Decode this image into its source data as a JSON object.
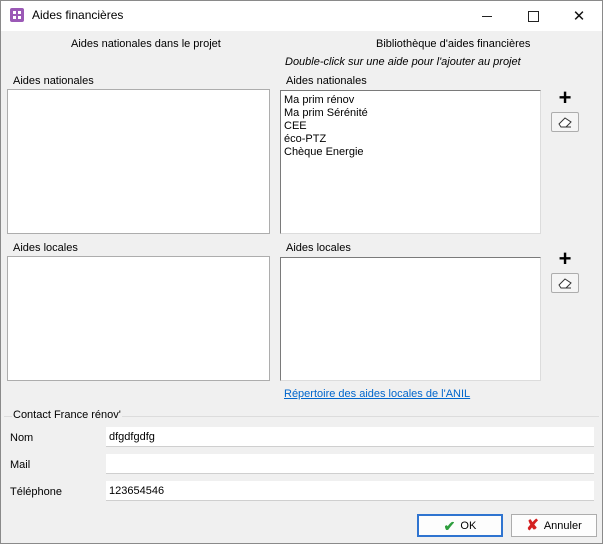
{
  "window": {
    "title": "Aides financières",
    "icon": "app-icon",
    "controls": {
      "minimize": "minimize-icon",
      "maximize": "maximize-icon",
      "close": "close-icon"
    }
  },
  "left": {
    "heading": "Aides nationales dans le projet",
    "national_label": "Aides nationales",
    "local_label": "Aides locales"
  },
  "right": {
    "heading": "Bibliothèque d'aides financières",
    "hint": "Double-click sur une aide pour l'ajouter au projet",
    "national_label": "Aides nationales",
    "national_items": [
      "Ma prim rénov",
      "Ma prim Sérénité",
      "CEE",
      "éco-PTZ",
      "Chèque Energie"
    ],
    "local_label": "Aides locales",
    "anil_link": "Répertoire des aides locales de l'ANIL",
    "add_icon": "plus-icon",
    "erase_icon": "eraser-icon"
  },
  "contact": {
    "title": "Contact France rénov'",
    "nom_label": "Nom",
    "nom_value": "dfgdfgdfg",
    "mail_label": "Mail",
    "mail_value": "",
    "tel_label": "Téléphone",
    "tel_value": "123654546"
  },
  "buttons": {
    "ok": "OK",
    "cancel": "Annuler"
  },
  "colors": {
    "accent": "#2f74d0",
    "link": "#0066cc",
    "ok_check": "#2e9e3e",
    "cancel_x": "#d42020",
    "app_icon": "#9b59b6"
  }
}
